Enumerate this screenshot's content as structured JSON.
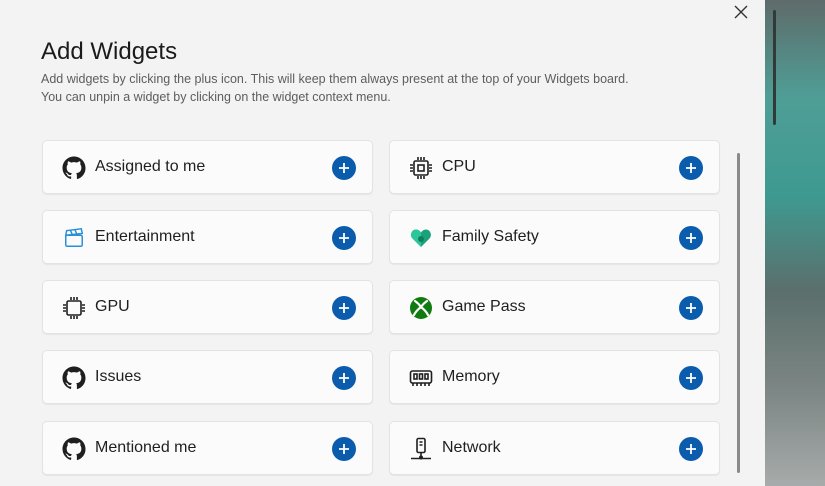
{
  "panel": {
    "title": "Add Widgets",
    "description_line1": "Add widgets by clicking the plus icon. This will keep them always present at the top of your Widgets board.",
    "description_line2": "You can unpin a widget by clicking on the widget context menu."
  },
  "widgets": [
    {
      "label": "Assigned to me",
      "icon": "github-icon"
    },
    {
      "label": "CPU",
      "icon": "cpu-icon"
    },
    {
      "label": "Entertainment",
      "icon": "entertainment-icon"
    },
    {
      "label": "Family Safety",
      "icon": "family-safety-icon"
    },
    {
      "label": "GPU",
      "icon": "gpu-icon"
    },
    {
      "label": "Game Pass",
      "icon": "xbox-icon"
    },
    {
      "label": "Issues",
      "icon": "github-icon"
    },
    {
      "label": "Memory",
      "icon": "memory-icon"
    },
    {
      "label": "Mentioned me",
      "icon": "github-icon"
    },
    {
      "label": "Network",
      "icon": "network-icon"
    }
  ],
  "colors": {
    "accent": "#0b5cad",
    "panel_bg": "#f3f3f3",
    "card_bg": "#fbfbfb"
  }
}
